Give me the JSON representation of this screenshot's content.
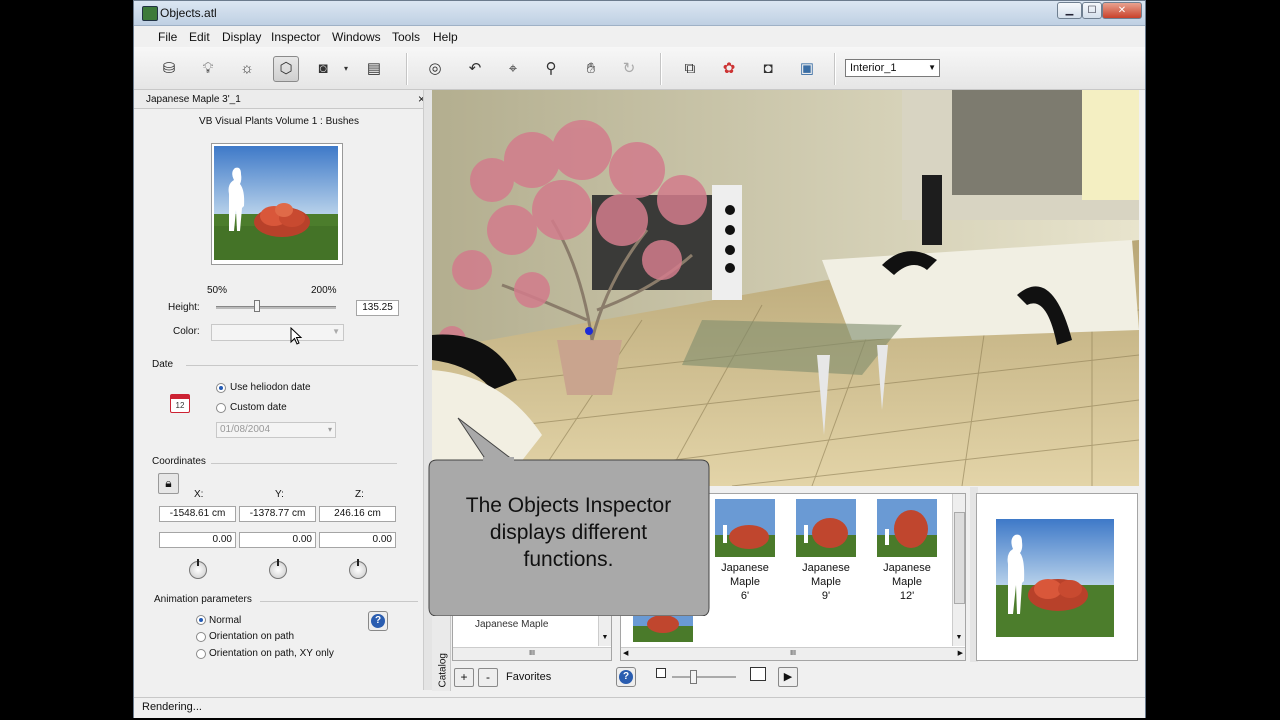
{
  "window": {
    "title": "Objects.atl",
    "minimize": "▁",
    "maximize": "☐",
    "close": "✕"
  },
  "menu": [
    "File",
    "Edit",
    "Display",
    "Inspector",
    "Windows",
    "Tools",
    "Help"
  ],
  "toolbar": {
    "view_select": "Interior_1",
    "icons": [
      "paint-bucket-icon",
      "light-bulb-icon",
      "sun-icon",
      "cube-icon",
      "camera-icon",
      "camera-menu-icon",
      "document-icon",
      "orbit-icon",
      "undo-rotate-icon",
      "crop-icon",
      "zoom-icon",
      "pan-hand-icon",
      "redo-icon",
      "window-grid-icon",
      "palette-icon",
      "render-camera-icon",
      "landscape-icon"
    ]
  },
  "inspector": {
    "header": "Japanese Maple 3'_1",
    "library": "VB Visual Plants Volume 1 : Bushes",
    "scale_min": "50%",
    "scale_max": "200%",
    "height_label": "Height:",
    "height_value": "135.25",
    "color_label": "Color:",
    "date_section": "Date",
    "use_heliodon": "Use heliodon date",
    "custom_date": "Custom date",
    "date_value": "01/08/2004",
    "calendar_day": "12",
    "coords_section": "Coordinates",
    "x_label": "X:",
    "y_label": "Y:",
    "z_label": "Z:",
    "x_value": "-1548.61 cm",
    "y_value": "-1378.77 cm",
    "z_value": "246.16 cm",
    "rx_value": "0.00",
    "ry_value": "0.00",
    "rz_value": "0.00",
    "anim_section": "Animation parameters",
    "anim_normal": "Normal",
    "anim_path": "Orientation on path",
    "anim_path_xy": "Orientation on path, XY only"
  },
  "catalog": {
    "tab_label": "Catalog",
    "tree_item": "Japanese Maple",
    "favorites": "Favorites",
    "add": "+",
    "remove": "-",
    "thumbs": [
      {
        "line1": "Japanese Maple",
        "line2": "6'"
      },
      {
        "line1": "Japanese Maple",
        "line2": "9'"
      },
      {
        "line1": "Japanese Maple",
        "line2": "12'"
      }
    ],
    "scroll_handle": "III"
  },
  "callout": {
    "text_line1": "The Objects Inspector",
    "text_line2": "displays different",
    "text_line3": "functions."
  },
  "status": {
    "text": "Rendering..."
  },
  "colors": {
    "accent": "#245bb5",
    "window_bg": "#f0f0f0",
    "callout_fill": "#a9a9a9"
  }
}
